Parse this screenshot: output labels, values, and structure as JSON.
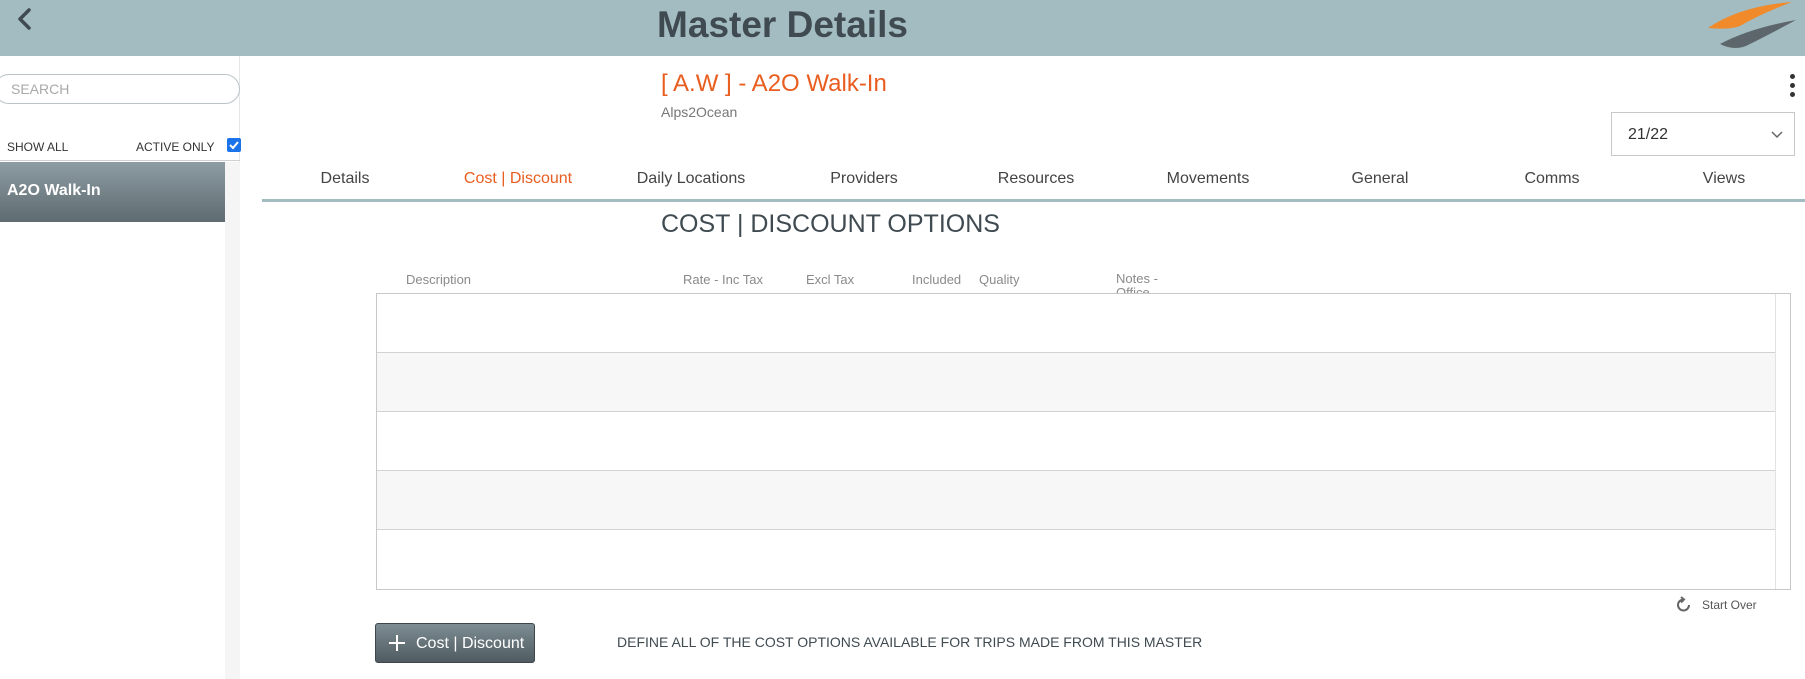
{
  "header": {
    "title": "Master Details",
    "back_icon": "chevron-left-icon",
    "logo": "swoosh-logo"
  },
  "sidebar": {
    "search_placeholder": "SEARCH",
    "show_all_label": "SHOW ALL",
    "active_only_label": "ACTIVE ONLY",
    "active_only_checked": true,
    "items": [
      {
        "label": "A2O Walk-In",
        "selected": true
      }
    ]
  },
  "record": {
    "title": "[ A.W ] - A2O Walk-In",
    "subtitle": "Alps2Ocean",
    "year_selected": "21/22"
  },
  "tabs": [
    {
      "label": "Details",
      "active": false
    },
    {
      "label": "Cost | Discount",
      "active": true
    },
    {
      "label": "Daily Locations",
      "active": false
    },
    {
      "label": "Providers",
      "active": false
    },
    {
      "label": "Resources",
      "active": false
    },
    {
      "label": "Movements",
      "active": false
    },
    {
      "label": "General",
      "active": false
    },
    {
      "label": "Comms",
      "active": false
    },
    {
      "label": "Views",
      "active": false
    }
  ],
  "section": {
    "title": "COST | DISCOUNT OPTIONS",
    "columns": [
      "Description",
      "Rate - Inc Tax",
      "Excl Tax",
      "Included",
      "Quality",
      "Notes - Office"
    ],
    "rows": [],
    "start_over_label": "Start Over",
    "add_button_label": "Cost | Discount",
    "hint": "DEFINE ALL OF THE COST OPTIONS AVAILABLE FOR TRIPS MADE FROM THIS MASTER"
  },
  "colors": {
    "header_bg": "#a3bcc1",
    "accent": "#e95d1f",
    "dark_text": "#3f4a51",
    "button_dark": "#5e6b71"
  }
}
